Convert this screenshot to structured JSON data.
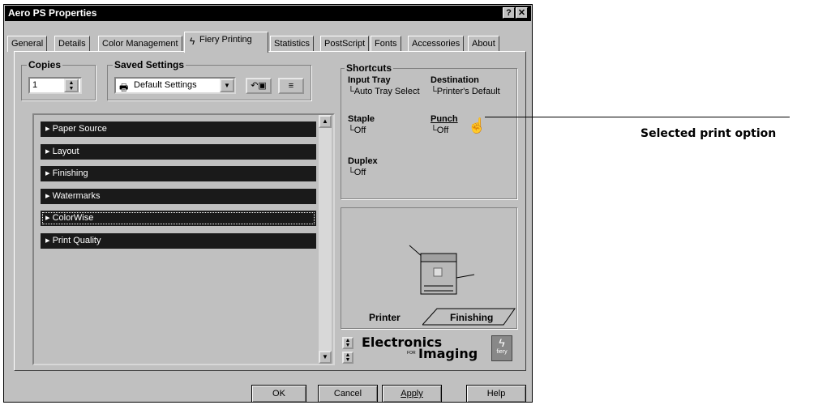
{
  "window": {
    "title": "Aero PS Properties",
    "help_btn": "?",
    "close_btn": "✕"
  },
  "tabs": [
    "General",
    "Details",
    "Color Management",
    "Fiery Printing",
    "Statistics",
    "PostScript",
    "Fonts",
    "Accessories",
    "About"
  ],
  "active_tab": "Fiery Printing",
  "copies": {
    "label": "Copies",
    "value": "1"
  },
  "saved_settings": {
    "label": "Saved Settings",
    "value": "Default Settings"
  },
  "sections": [
    "Paper Source",
    "Layout",
    "Finishing",
    "Watermarks",
    "ColorWise",
    "Print Quality"
  ],
  "shortcuts": {
    "label": "Shortcuts",
    "input_tray": {
      "label": "Input Tray",
      "value": "Auto Tray Select"
    },
    "destination": {
      "label": "Destination",
      "value": "Printer's Default"
    },
    "staple": {
      "label": "Staple",
      "value": "Off"
    },
    "punch": {
      "label": "Punch",
      "value": "Off"
    },
    "duplex": {
      "label": "Duplex",
      "value": "Off"
    }
  },
  "preview_tabs": {
    "printer": "Printer",
    "finishing": "Finishing"
  },
  "logo": {
    "line1": "Electronics",
    "for": "FOR",
    "line2": "Imaging",
    "badge": "fiery"
  },
  "buttons": {
    "ok": "OK",
    "cancel": "Cancel",
    "apply": "Apply",
    "help": "Help"
  },
  "callout": "Selected print option"
}
